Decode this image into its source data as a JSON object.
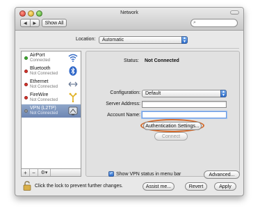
{
  "window": {
    "title": "Network",
    "show_all_label": "Show All",
    "search": {
      "placeholder": ""
    }
  },
  "location": {
    "label": "Location:",
    "value": "Automatic"
  },
  "services": [
    {
      "name": "AirPort",
      "status": "Connected",
      "dot_color": "#3fae2f",
      "icon": "wifi-icon",
      "selected": false
    },
    {
      "name": "Bluetooth",
      "status": "Not Connected",
      "dot_color": "#d8332a",
      "icon": "bluetooth-icon",
      "selected": false
    },
    {
      "name": "Ethernet",
      "status": "Not Connected",
      "dot_color": "#d8332a",
      "icon": "ethernet-icon",
      "selected": false
    },
    {
      "name": "FireWire",
      "status": "Not Connected",
      "dot_color": "#d8332a",
      "icon": "firewire-icon",
      "selected": false
    },
    {
      "name": "VPN (L2TP)",
      "status": "Not Connected",
      "dot_color": "#9a9a9a",
      "icon": "vpn-icon",
      "selected": true
    }
  ],
  "list_tools": {
    "add": "+",
    "remove": "−",
    "action": "⚙▾"
  },
  "detail": {
    "status_label": "Status:",
    "status_value": "Not Connected",
    "configuration_label": "Configuration:",
    "configuration_value": "Default",
    "server_address_label": "Server Address:",
    "server_address_value": "",
    "account_name_label": "Account Name:",
    "account_name_value": "",
    "auth_settings_label": "Authentication Settings...",
    "connect_label": "Connect",
    "show_vpn_status_label": "Show VPN status in menu bar",
    "show_vpn_status_checked": true,
    "advanced_label": "Advanced...",
    "help_label": "?"
  },
  "footer": {
    "lock_text": "Click the lock to prevent further changes.",
    "assist_label": "Assist me...",
    "revert_label": "Revert",
    "apply_label": "Apply"
  },
  "colors": {
    "highlight_ring": "#d46a2b",
    "selection": "#7a92bd"
  }
}
